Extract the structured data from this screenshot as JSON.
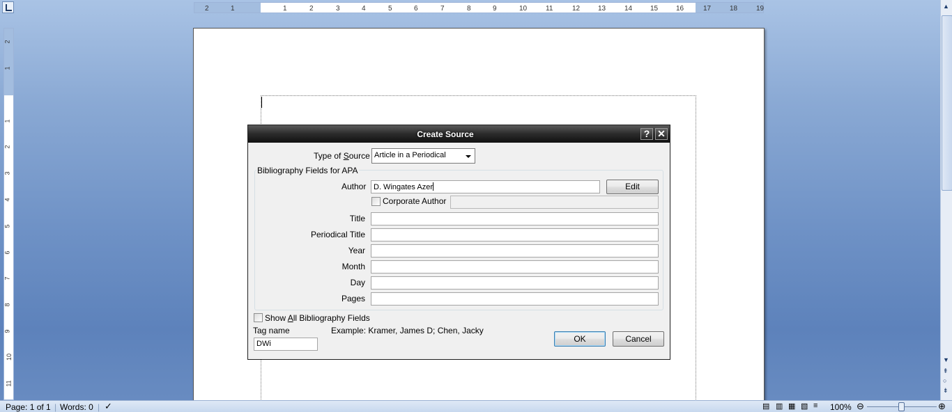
{
  "dialog": {
    "title": "Create Source",
    "help_glyph": "?",
    "close_glyph": "✕",
    "type_of_source_label_pre": "Type of ",
    "type_of_source_label_u": "S",
    "type_of_source_label_post": "ource",
    "type_of_source_value": "Article in a Periodical",
    "group_label": "Bibliography Fields for APA",
    "author_label": "Author",
    "author_value": "D. Wingates Azer",
    "edit_label": "Edit",
    "corporate_author_label": "Corporate Author",
    "fields": [
      {
        "label": "Title",
        "value": ""
      },
      {
        "label": "Periodical Title",
        "value": ""
      },
      {
        "label": "Year",
        "value": ""
      },
      {
        "label": "Month",
        "value": ""
      },
      {
        "label": "Day",
        "value": ""
      },
      {
        "label": "Pages",
        "value": ""
      }
    ],
    "show_all_pre": "Show ",
    "show_all_u": "A",
    "show_all_post": "ll Bibliography Fields",
    "tag_name_label": "Tag name",
    "example_text": "Example: Kramer, James D; Chen, Jacky",
    "tag_name_value": "DWi",
    "ok_label": "OK",
    "cancel_label": "Cancel"
  },
  "ruler": {
    "top_ticks": [
      "2",
      "1",
      "1",
      "2",
      "3",
      "4",
      "5",
      "6",
      "7",
      "8",
      "9",
      "10",
      "11",
      "12",
      "13",
      "14",
      "15",
      "16",
      "17",
      "18",
      "19"
    ],
    "left_ticks": [
      "2",
      "1",
      "1",
      "2",
      "3",
      "4",
      "5",
      "6",
      "7",
      "8",
      "9",
      "10",
      "11"
    ]
  },
  "status": {
    "page": "Page: 1 of 1",
    "words": "Words: 0",
    "zoom": "100%"
  },
  "colors": {
    "workspace": "#6f92c6",
    "titlebar": "#2b2b2b",
    "dialog_bg": "#f0f0f0"
  }
}
